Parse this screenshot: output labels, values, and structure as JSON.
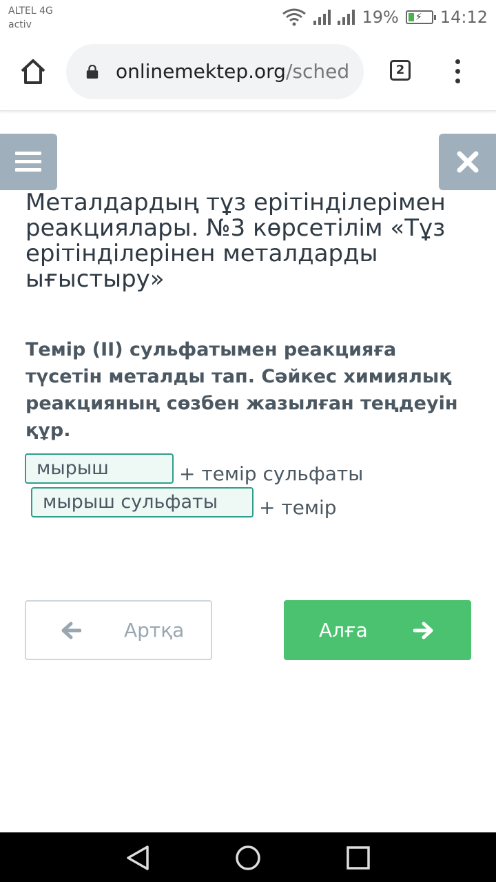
{
  "status_bar": {
    "carrier_line1": "ALTEL 4G",
    "carrier_line2": "activ",
    "battery": "19%",
    "time": "14:12"
  },
  "browser": {
    "url_host": "onlinemektep.org",
    "url_rest": "/sched",
    "tab_count": "2"
  },
  "lesson": {
    "title": "Металдардың тұз ерітінділерімен реакциялары. №3 көрсетілім «Тұз ерітінділерінен металдарды ығыстыру»",
    "question": "Темір (II) сульфатымен реакцияға түсетін металды тап. Сәйкес химиялық реакцияның сөзбен жазылған теңдеуін құр.",
    "answer1": "мырыш",
    "equation_part1": "+ темір сульфаты",
    "answer2": "мырыш сульфаты",
    "equation_part2": "+ темір"
  },
  "nav_buttons": {
    "back_label": "Артқа",
    "next_label": "Алға",
    "next_color": "#4bc26f"
  },
  "icons": [
    "home-icon",
    "lock-icon",
    "tabs-icon",
    "more-vert-icon",
    "hamburger-icon",
    "close-icon",
    "arrow-left-icon",
    "arrow-right-icon",
    "back-triangle-icon",
    "home-circle-icon",
    "recents-square-icon"
  ]
}
